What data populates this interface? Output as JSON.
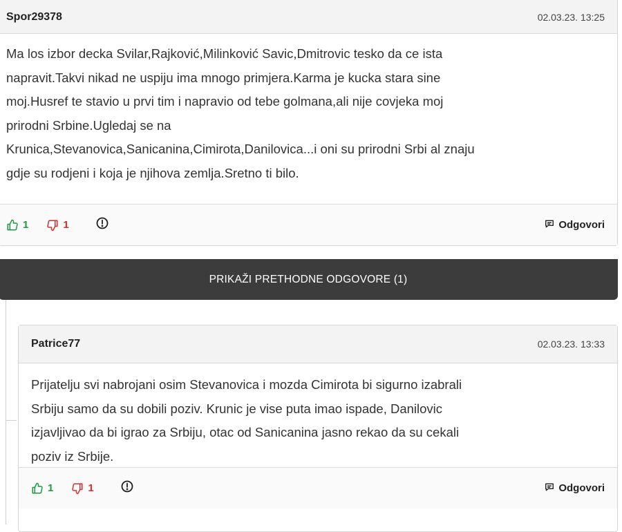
{
  "comments": [
    {
      "username": "Spor29378",
      "timestamp": "02.03.23. 13:25",
      "lines": [
        "Ma los izbor decka Svilar,Rajković,Milinković Savic,Dmitrovic tesko da ce ista",
        "napravit.Takvi nikad ne uspiju ima mnogo primjera.Karma je kucka stara sine",
        "moj.Husref te stavio u prvi tim i napravio od tebe golmana,ali nije covjeka moj",
        "prirodni Srbine.Ugledaj se na",
        "Krunica,Stevanovica,Sanicanina,Cimirota,Danilovica...i oni su prirodni Srbi al znaju",
        "gdje su rodjeni i koja je njihova zemlja.Sretno ti bilo."
      ],
      "likes": "1",
      "dislikes": "1",
      "reply_label": "Odgovori"
    },
    {
      "username": "Patrice77",
      "timestamp": "02.03.23. 13:33",
      "lines": [
        "Prijatelju svi nabrojani osim Stevanovica i mozda Cimirota bi sigurno izabrali",
        "Srbiju samo da su dobili poziv. Krunic je vise puta imao ispade, Danilovic",
        "izjavljivao da bi igrao za Srbiju, otac od Sanicanina jasno rekao da su cekali",
        "poziv iz Srbije."
      ],
      "likes": "1",
      "dislikes": "1",
      "reply_label": "Odgovori"
    }
  ],
  "show_previous_label": "PRIKAŽI PRETHODNE ODGOVORE (1)",
  "icons": {
    "like": "thumbs-up-icon",
    "dislike": "thumbs-down-icon",
    "report": "exclamation-circle-icon",
    "reply": "speech-bubble-icon"
  },
  "colors": {
    "like": "#1e9a3c",
    "dislike": "#d32f2f",
    "bar": "#3c3c3c",
    "header_bg": "#f3f3f3"
  }
}
